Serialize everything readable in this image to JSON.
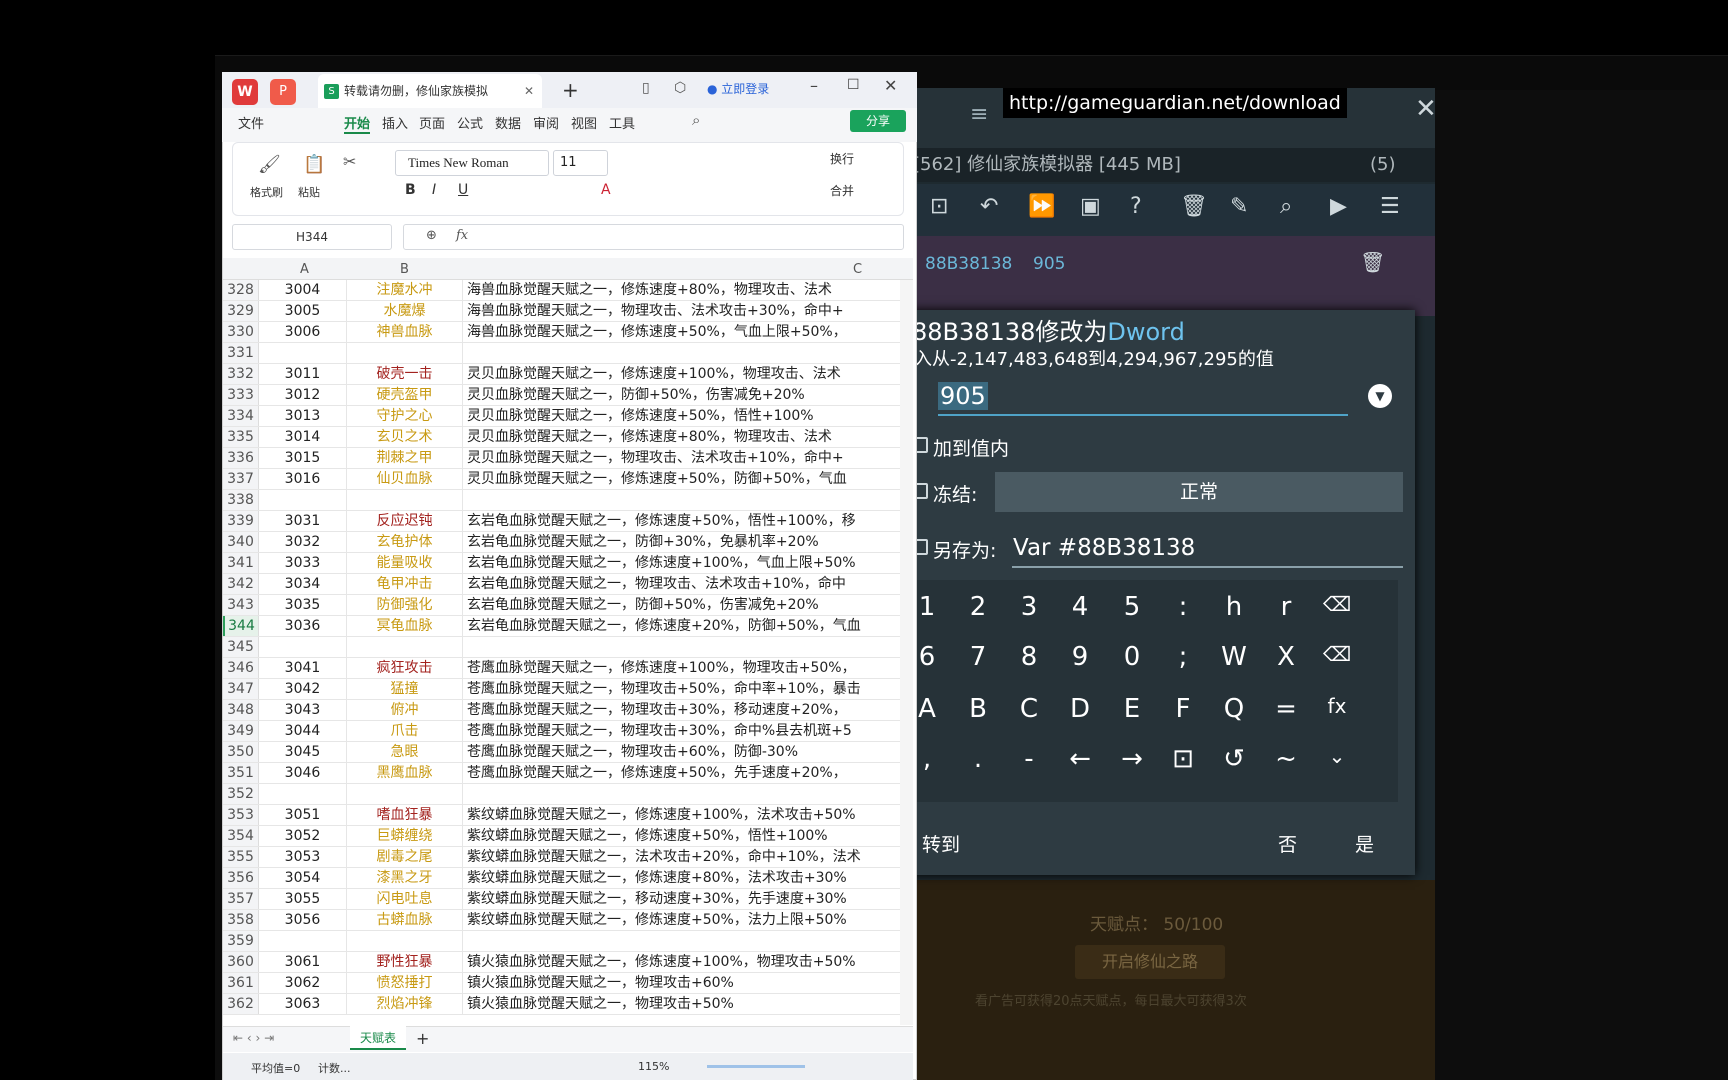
{
  "wps": {
    "tab_title": "转载请勿删，修仙家族模拟",
    "login_label": "立即登录",
    "menu": [
      "文件",
      "开始",
      "插入",
      "页面",
      "公式",
      "数据",
      "审阅",
      "视图",
      "工具"
    ],
    "share_label": "分享",
    "ribbon": {
      "format_painter": "格式刷",
      "paste": "粘贴",
      "font_name": "Times New Roman",
      "font_size": "11",
      "wrap": "换行",
      "merge": "合并"
    },
    "name_box": "H344",
    "fx": "fx",
    "columns": [
      "A",
      "B",
      "C"
    ],
    "rows": [
      {
        "n": "328",
        "a": "3004",
        "b": "注魔水冲",
        "cls": "yel",
        "c": "海兽血脉觉醒天赋之一，修炼速度+80%，物理攻击、法术"
      },
      {
        "n": "329",
        "a": "3005",
        "b": "水魔爆",
        "cls": "yel",
        "c": "海兽血脉觉醒天赋之一，物理攻击、法术攻击+30%，命中+"
      },
      {
        "n": "330",
        "a": "3006",
        "b": "神兽血脉",
        "cls": "yel",
        "c": "海兽血脉觉醒天赋之一，修炼速度+50%，气血上限+50%，"
      },
      {
        "n": "331",
        "a": "",
        "b": "",
        "cls": "",
        "c": ""
      },
      {
        "n": "332",
        "a": "3011",
        "b": "破壳一击",
        "cls": "red",
        "c": "灵贝血脉觉醒天赋之一，修炼速度+100%，物理攻击、法术"
      },
      {
        "n": "333",
        "a": "3012",
        "b": "硬壳盔甲",
        "cls": "yel",
        "c": "灵贝血脉觉醒天赋之一，防御+50%，伤害减免+20%"
      },
      {
        "n": "334",
        "a": "3013",
        "b": "守护之心",
        "cls": "yel",
        "c": "灵贝血脉觉醒天赋之一，修炼速度+50%，悟性+100%"
      },
      {
        "n": "335",
        "a": "3014",
        "b": "玄贝之术",
        "cls": "yel",
        "c": "灵贝血脉觉醒天赋之一，修炼速度+80%，物理攻击、法术"
      },
      {
        "n": "336",
        "a": "3015",
        "b": "荆棘之甲",
        "cls": "yel",
        "c": "灵贝血脉觉醒天赋之一，物理攻击、法术攻击+10%，命中+"
      },
      {
        "n": "337",
        "a": "3016",
        "b": "仙贝血脉",
        "cls": "yel",
        "c": "灵贝血脉觉醒天赋之一，修炼速度+50%，防御+50%，气血"
      },
      {
        "n": "338",
        "a": "",
        "b": "",
        "cls": "",
        "c": ""
      },
      {
        "n": "339",
        "a": "3031",
        "b": "反应迟钝",
        "cls": "red",
        "c": "玄岩龟血脉觉醒天赋之一，修炼速度+50%，悟性+100%，移"
      },
      {
        "n": "340",
        "a": "3032",
        "b": "玄龟护体",
        "cls": "yel",
        "c": "玄岩龟血脉觉醒天赋之一，防御+30%，免暴机率+20%"
      },
      {
        "n": "341",
        "a": "3033",
        "b": "能量吸收",
        "cls": "yel",
        "c": "玄岩龟血脉觉醒天赋之一，修炼速度+100%，气血上限+50%"
      },
      {
        "n": "342",
        "a": "3034",
        "b": "龟甲冲击",
        "cls": "yel",
        "c": "玄岩龟血脉觉醒天赋之一，物理攻击、法术攻击+10%，命中"
      },
      {
        "n": "343",
        "a": "3035",
        "b": "防御强化",
        "cls": "yel",
        "c": "玄岩龟血脉觉醒天赋之一，防御+50%，伤害减免+20%"
      },
      {
        "n": "344",
        "a": "3036",
        "b": "冥龟血脉",
        "cls": "yel",
        "c": "玄岩龟血脉觉醒天赋之一，修炼速度+20%，防御+50%，气血"
      },
      {
        "n": "345",
        "a": "",
        "b": "",
        "cls": "",
        "c": ""
      },
      {
        "n": "346",
        "a": "3041",
        "b": "疯狂攻击",
        "cls": "red",
        "c": "苍鹰血脉觉醒天赋之一，修炼速度+100%，物理攻击+50%，"
      },
      {
        "n": "347",
        "a": "3042",
        "b": "猛撞",
        "cls": "yel",
        "c": "苍鹰血脉觉醒天赋之一，物理攻击+50%，命中率+10%，暴击"
      },
      {
        "n": "348",
        "a": "3043",
        "b": "俯冲",
        "cls": "yel",
        "c": "苍鹰血脉觉醒天赋之一，物理攻击+30%，移动速度+20%，"
      },
      {
        "n": "349",
        "a": "3044",
        "b": "爪击",
        "cls": "yel",
        "c": "苍鹰血脉觉醒天赋之一，物理攻击+30%，命中%县去机斑+5"
      },
      {
        "n": "350",
        "a": "3045",
        "b": "急眼",
        "cls": "yel",
        "c": "苍鹰血脉觉醒天赋之一，物理攻击+60%，防御-30%"
      },
      {
        "n": "351",
        "a": "3046",
        "b": "黑鹰血脉",
        "cls": "yel",
        "c": "苍鹰血脉觉醒天赋之一，修炼速度+50%，先手速度+20%，"
      },
      {
        "n": "352",
        "a": "",
        "b": "",
        "cls": "",
        "c": ""
      },
      {
        "n": "353",
        "a": "3051",
        "b": "嗜血狂暴",
        "cls": "red",
        "c": "紫纹蟒血脉觉醒天赋之一，修炼速度+100%，法术攻击+50%"
      },
      {
        "n": "354",
        "a": "3052",
        "b": "巨蟒缠绕",
        "cls": "yel",
        "c": "紫纹蟒血脉觉醒天赋之一，修炼速度+50%，悟性+100%"
      },
      {
        "n": "355",
        "a": "3053",
        "b": "剧毒之尾",
        "cls": "yel",
        "c": "紫纹蟒血脉觉醒天赋之一，法术攻击+20%，命中+10%，法术"
      },
      {
        "n": "356",
        "a": "3054",
        "b": "漆黑之牙",
        "cls": "yel",
        "c": "紫纹蟒血脉觉醒天赋之一，修炼速度+80%，法术攻击+30%"
      },
      {
        "n": "357",
        "a": "3055",
        "b": "闪电吐息",
        "cls": "yel",
        "c": "紫纹蟒血脉觉醒天赋之一，移动速度+30%，先手速度+30%"
      },
      {
        "n": "358",
        "a": "3056",
        "b": "古蟒血脉",
        "cls": "yel",
        "c": "紫纹蟒血脉觉醒天赋之一，修炼速度+50%，法力上限+50%"
      },
      {
        "n": "359",
        "a": "",
        "b": "",
        "cls": "",
        "c": ""
      },
      {
        "n": "360",
        "a": "3061",
        "b": "野性狂暴",
        "cls": "red",
        "c": "镇火猿血脉觉醒天赋之一，修炼速度+100%，物理攻击+50%"
      },
      {
        "n": "361",
        "a": "3062",
        "b": "愤怒捶打",
        "cls": "yel",
        "c": "镇火猿血脉觉醒天赋之一，物理攻击+60%"
      },
      {
        "n": "362",
        "a": "3063",
        "b": "烈焰冲锋",
        "cls": "yel",
        "c": "镇火猿血脉觉醒天赋之一，物理攻击+50%"
      }
    ],
    "sheet_tab": "天赋表",
    "status": {
      "avg": "平均值=0",
      "count": "计数...",
      "zoom": "115%"
    }
  },
  "gg": {
    "url": "http://gameguardian.net/download",
    "process": "[562] 修仙家族模拟器 [445 MB]",
    "count": "(5)",
    "result_addr": "88B38138",
    "result_val": "905",
    "dialog": {
      "title_prefix": "88B38138修改为",
      "title_type": "Dword",
      "range": "入从-2,147,483,648到4,294,967,295的值",
      "value": "905",
      "add_label": "加到值内",
      "freeze_label": "冻结:",
      "freeze_value": "正常",
      "saveas_label": "另存为:",
      "saveas_value": "Var #88B38138",
      "goto": "转到",
      "no": "否",
      "yes": "是"
    },
    "keys": [
      [
        "1",
        "2",
        "3",
        "4",
        "5",
        ":",
        "h",
        "r",
        "⌫"
      ],
      [
        "6",
        "7",
        "8",
        "9",
        "0",
        ";",
        "W",
        "X",
        "⌫"
      ],
      [
        "A",
        "B",
        "C",
        "D",
        "E",
        "F",
        "Q",
        "=",
        "fx"
      ],
      [
        ",",
        ".",
        "-",
        "←",
        "→",
        "⊡",
        "↺",
        "~",
        "⌄"
      ]
    ],
    "game": {
      "talent_points": "天赋点： 50/100",
      "start_button": "开启修仙之路",
      "ad_text": "看广告可获得20点天赋点，每日最大可获得3次"
    }
  }
}
